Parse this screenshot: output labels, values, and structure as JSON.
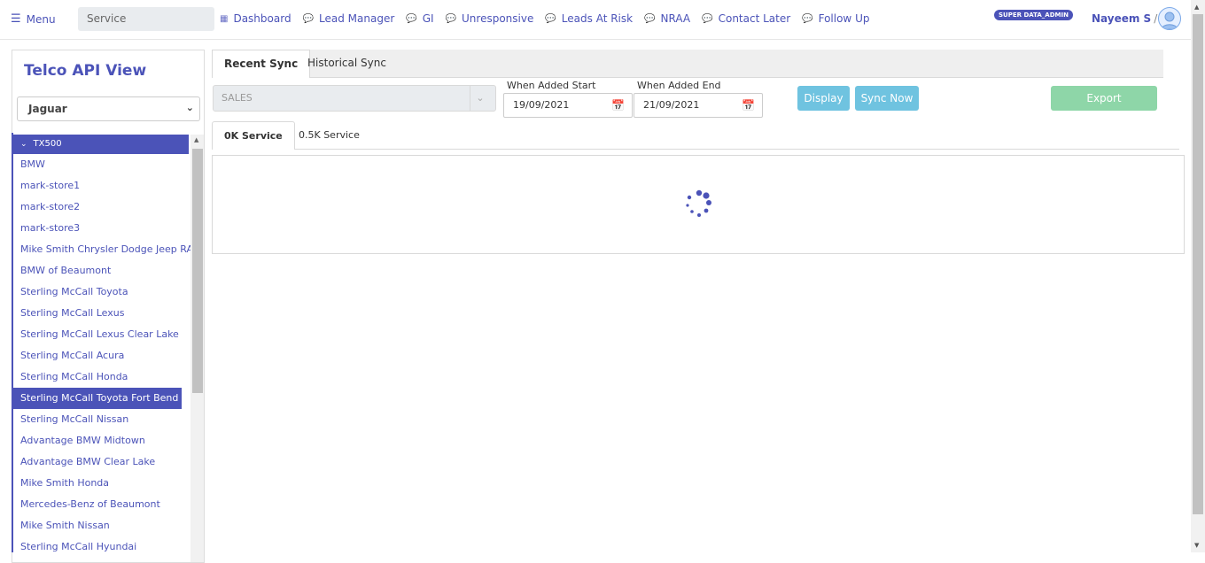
{
  "nav": {
    "menu_label": "Menu",
    "service_value": "Service",
    "items": [
      {
        "label": "Dashboard",
        "icon": "building-icon"
      },
      {
        "label": "Lead Manager",
        "icon": "chat-icon"
      },
      {
        "label": "GI",
        "icon": "chat-icon"
      },
      {
        "label": "Unresponsive",
        "icon": "chat-icon"
      },
      {
        "label": "Leads At Risk",
        "icon": "chat-icon"
      },
      {
        "label": "NRAA",
        "icon": "chat-icon"
      },
      {
        "label": "Contact Later",
        "icon": "chat-icon"
      },
      {
        "label": "Follow Up",
        "icon": "chat-icon"
      }
    ],
    "role_badge": "SUPER DATA_ADMIN",
    "user_name": "Nayeem S",
    "user_sep": "/"
  },
  "sidebar": {
    "title": "Telco API View",
    "brand_value": "Jaguar",
    "group_label": "TX500",
    "stores": [
      "BMW",
      "mark-store1",
      "mark-store2",
      "mark-store3",
      "Mike Smith Chrysler Dodge Jeep RAM",
      "BMW of Beaumont",
      "Sterling McCall Toyota",
      "Sterling McCall Lexus",
      "Sterling McCall Lexus Clear Lake",
      "Sterling McCall Acura",
      "Sterling McCall Honda",
      "Sterling McCall Toyota Fort Bend",
      "Sterling McCall Nissan",
      "Advantage BMW Midtown",
      "Advantage BMW Clear Lake",
      "Mike Smith Honda",
      "Mercedes-Benz of Beaumont",
      "Mike Smith Nissan",
      "Sterling McCall Hyundai"
    ],
    "active_store": "Sterling McCall Toyota Fort Bend"
  },
  "main": {
    "tabs": [
      "Recent Sync",
      "Historical Sync"
    ],
    "active_tab": "Recent Sync",
    "dept_value": "SALES",
    "start_label": "When Added Start",
    "start_value": "19/09/2021",
    "end_label": "When Added End",
    "end_value": "21/09/2021",
    "display_btn": "Display",
    "sync_btn": "Sync Now",
    "export_btn": "Export",
    "sub_tabs": [
      "0K Service",
      "0.5K Service"
    ],
    "active_sub_tab": "0K Service"
  },
  "colors": {
    "brand": "#4b53b8",
    "info_button": "#6fc3e0",
    "success_button": "#8ed6a8"
  }
}
